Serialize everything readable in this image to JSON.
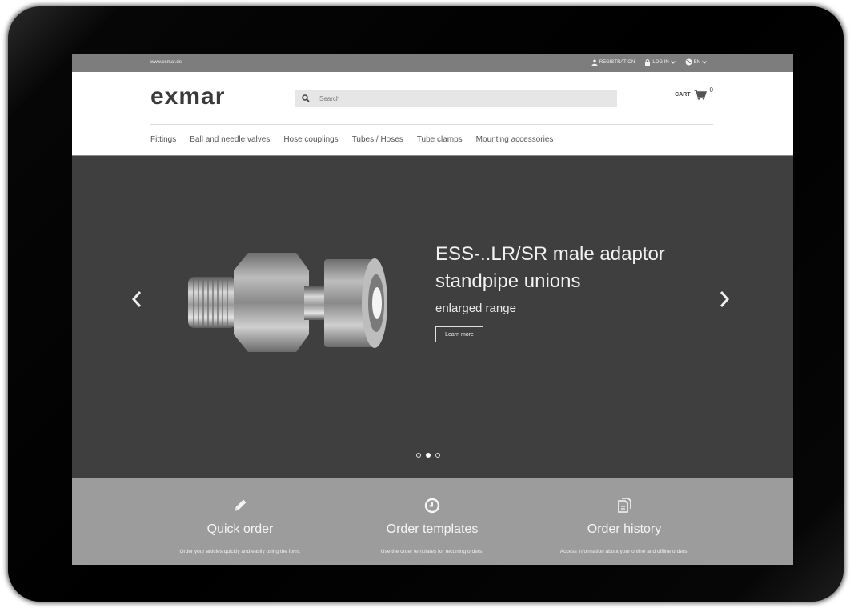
{
  "topbar": {
    "url": "www.exmar.de",
    "registration": "REGISTRATION",
    "login": "LOG IN",
    "language": "EN"
  },
  "header": {
    "logo": "exmar",
    "search_placeholder": "Search",
    "cart_label": "CART",
    "cart_count": "0"
  },
  "nav": {
    "items": [
      "Fittings",
      "Ball and needle valves",
      "Hose couplings",
      "Tubes / Hoses",
      "Tube clamps",
      "Mounting accessories"
    ]
  },
  "hero": {
    "title": "ESS-..LR/SR male adaptor standpipe unions",
    "subtitle": "enlarged range",
    "button": "Learn more",
    "slide_count": 3,
    "active_slide": 2
  },
  "features": [
    {
      "title": "Quick order",
      "desc": "Order your articles quickly and easily using the form.",
      "icon": "pencil-icon"
    },
    {
      "title": "Order templates",
      "desc": "Use the order templates for recurring orders.",
      "icon": "clock-icon"
    },
    {
      "title": "Order history",
      "desc": "Access information about your online and offline orders.",
      "icon": "documents-icon"
    }
  ]
}
